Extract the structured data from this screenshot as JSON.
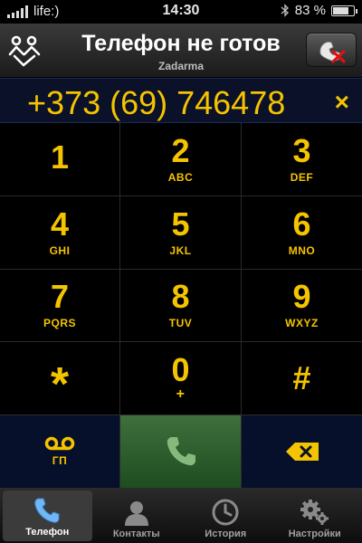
{
  "status_bar": {
    "carrier": "life:)",
    "time": "14:30",
    "battery_text": "83 %",
    "battery_level": 0.83
  },
  "header": {
    "title": "Телефон не готов",
    "subtitle": "Zadarma",
    "logo_icon": "zadarma-logo-icon",
    "hangup_icon": "hangup-phone-x-icon"
  },
  "dialer": {
    "number": "+373 (69) 746478",
    "clear_symbol": "×"
  },
  "keypad": {
    "k1": {
      "digit": "1",
      "letters": ""
    },
    "k2": {
      "digit": "2",
      "letters": "ABC"
    },
    "k3": {
      "digit": "3",
      "letters": "DEF"
    },
    "k4": {
      "digit": "4",
      "letters": "GHI"
    },
    "k5": {
      "digit": "5",
      "letters": "JKL"
    },
    "k6": {
      "digit": "6",
      "letters": "MNO"
    },
    "k7": {
      "digit": "7",
      "letters": "PQRS"
    },
    "k8": {
      "digit": "8",
      "letters": "TUV"
    },
    "k9": {
      "digit": "9",
      "letters": "WXYZ"
    },
    "kstar": {
      "digit": "*"
    },
    "k0": {
      "digit": "0",
      "letters": "+"
    },
    "khash": {
      "digit": "#"
    },
    "voicemail_label": "ГП"
  },
  "tabs": [
    {
      "label": "Телефон",
      "icon": "phone-icon",
      "active": true
    },
    {
      "label": "Контакты",
      "icon": "contacts-icon",
      "active": false
    },
    {
      "label": "История",
      "icon": "clock-icon",
      "active": false
    },
    {
      "label": "Настройки",
      "icon": "gears-icon",
      "active": false
    }
  ],
  "colors": {
    "accent": "#f5c400",
    "number_bar": "#0a1128",
    "call_green": "#2f6a30"
  }
}
